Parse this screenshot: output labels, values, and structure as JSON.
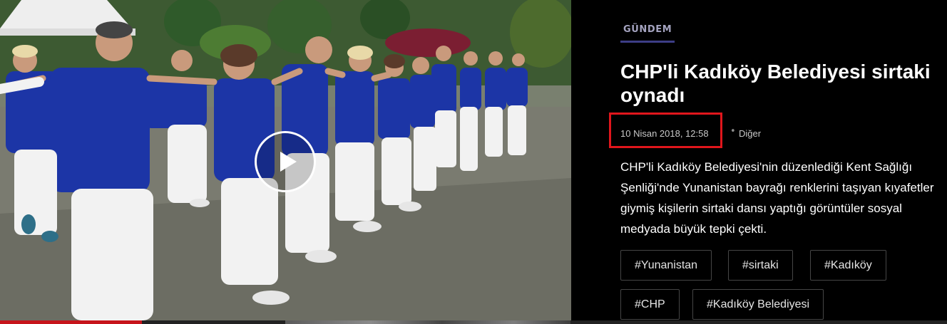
{
  "video": {
    "play_icon": "play-icon",
    "progress_fraction": 0.15
  },
  "article": {
    "category": "GÜNDEM",
    "title": "CHP'li Kadıköy Belediyesi sirtaki oynadı",
    "date": "10 Nisan 2018, 12:58",
    "separator": "•",
    "source": "Diğer",
    "summary": "CHP'li Kadıköy Belediyesi'nin düzenlediği Kent Sağlığı Şenliği'nde Yunanistan bayrağı renklerini taşıyan kıyafetler giymiş kişilerin sirtaki dansı yaptığı görüntüler sosyal medyada büyük tepki çekti.",
    "tags": [
      "#Yunanistan",
      "#sirtaki",
      "#Kadıköy",
      "#CHP",
      "#Kadıköy Belediyesi"
    ]
  },
  "colors": {
    "panel_background": "#000000",
    "category_underline": "#3d3e86",
    "highlight_box": "#e0161c",
    "dancer_shirt": "#1c35a6"
  }
}
